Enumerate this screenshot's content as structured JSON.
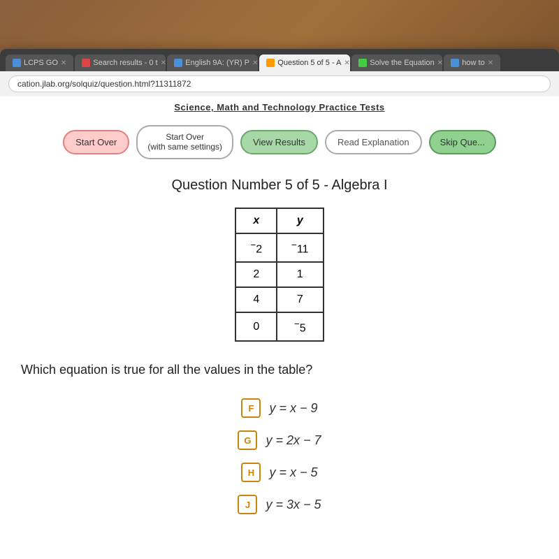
{
  "desktop": {
    "background": "wooden table"
  },
  "browser": {
    "tabs": [
      {
        "label": "LCPS GO",
        "active": false,
        "color": "#4a90d9"
      },
      {
        "label": "Search results - 0 t",
        "active": false,
        "color": "#d44"
      },
      {
        "label": "English 9A: (YR) P",
        "active": false,
        "color": "#4a90d9"
      },
      {
        "label": "Question 5 of 5 - A",
        "active": true,
        "color": "#f90"
      },
      {
        "label": "Solve the Equation",
        "active": false,
        "color": "#4c4"
      },
      {
        "label": "how to",
        "active": false,
        "color": "#4a90d9"
      }
    ],
    "address": "cation.jlab.org/solquiz/question.html?11311872"
  },
  "page": {
    "banner": "Science, Math and Technology Practice Tests",
    "toolbar": {
      "start_over_label": "Start Over",
      "start_over_settings_label": "Start Over\n(with same settings)",
      "view_results_label": "View Results",
      "read_explanation_label": "Read Explanation",
      "skip_label": "Skip Que..."
    },
    "question_title": "Question Number 5 of 5 - Algebra I",
    "table": {
      "headers": [
        "x",
        "y"
      ],
      "rows": [
        [
          "-2",
          "-11"
        ],
        [
          "2",
          "1"
        ],
        [
          "4",
          "7"
        ],
        [
          "0",
          "-5"
        ]
      ]
    },
    "question_text": "Which equation is true for all the values in the table?",
    "answers": [
      {
        "badge": "F",
        "equation": "y = x − 9"
      },
      {
        "badge": "G",
        "equation": "y = 2x − 7"
      },
      {
        "badge": "H",
        "equation": "y = x − 5"
      },
      {
        "badge": "J",
        "equation": "y = 3x − 5"
      }
    ]
  }
}
